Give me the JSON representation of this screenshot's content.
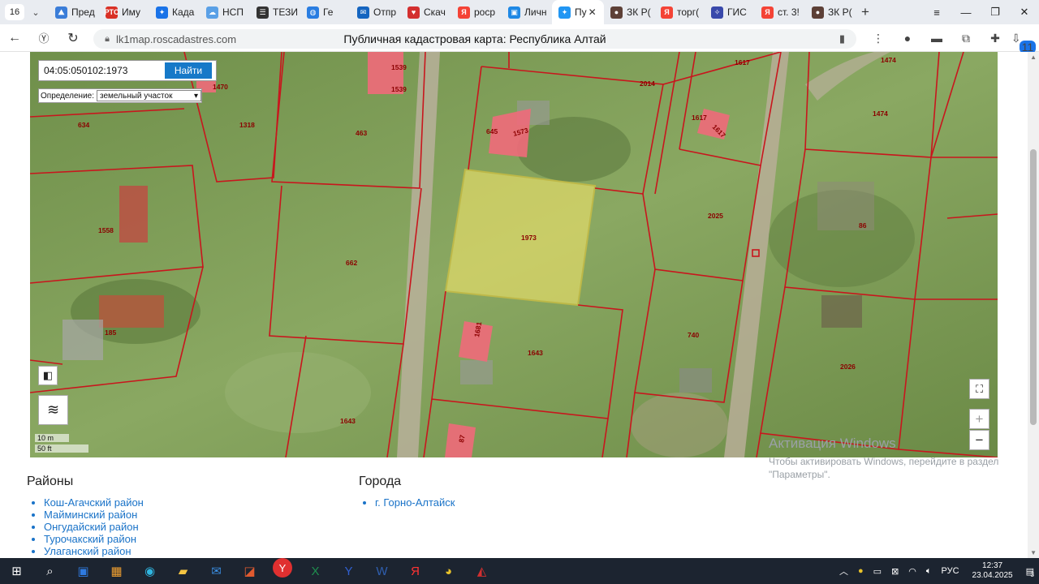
{
  "tabs": {
    "count": "16",
    "items": [
      {
        "label": "Пред",
        "color": "#3b7dd8",
        "glyph": "⛰"
      },
      {
        "label": "Иму",
        "color": "#d93025",
        "glyph": "РТС"
      },
      {
        "label": "Када",
        "color": "#1a73e8",
        "glyph": "✦"
      },
      {
        "label": "НСП",
        "color": "#5aa0e6",
        "glyph": "☁"
      },
      {
        "label": "ТЕЗИ",
        "color": "#333333",
        "glyph": "☰"
      },
      {
        "label": "Ге",
        "color": "#2a7de1",
        "glyph": "◍"
      },
      {
        "label": "Отпр",
        "color": "#1565c0",
        "glyph": "✉"
      },
      {
        "label": "Скач",
        "color": "#d32f2f",
        "glyph": "♥"
      },
      {
        "label": "роср",
        "color": "#f44336",
        "glyph": "Я"
      },
      {
        "label": "Личн",
        "color": "#1e88e5",
        "glyph": "▣"
      },
      {
        "label": "Пу",
        "color": "#2196f3",
        "glyph": "✦",
        "active": true
      },
      {
        "label": "ЗК Р(",
        "color": "#5d4037",
        "glyph": "●"
      },
      {
        "label": "торг(",
        "color": "#f44336",
        "glyph": "Я"
      },
      {
        "label": "ГИС",
        "color": "#3949ab",
        "glyph": "✧"
      },
      {
        "label": "ст. 3!",
        "color": "#f44336",
        "glyph": "Я"
      },
      {
        "label": "ЗК Р(",
        "color": "#5d4037",
        "glyph": "●"
      }
    ]
  },
  "address": {
    "url": "lk1map.roscadastres.com",
    "page_title": "Публичная кадастровая карта: Республика Алтай",
    "extensions_badge": "11"
  },
  "map": {
    "search_value": "04:05:050102:1973",
    "search_button": "Найти",
    "definition_label": "Определение:",
    "definition_value": "земельный участок",
    "scale_metric": "10 m",
    "scale_imperial": "50 ft",
    "plot_labels": [
      "1539",
      "1539",
      "463",
      "1318",
      "1470",
      "1318",
      "634",
      "645",
      "1573",
      "2014",
      "1617",
      "1617",
      "1474",
      "1474",
      "1558",
      "1973",
      "2025",
      "86",
      "662",
      "185",
      "1643",
      "1643",
      "740",
      "2026",
      "87",
      "1681",
      "1617"
    ]
  },
  "districts": {
    "title": "Районы",
    "items": [
      "Кош-Агачский район",
      "Майминский район",
      "Онгудайский район",
      "Турочакский район",
      "Улаганский район"
    ]
  },
  "cities": {
    "title": "Города",
    "items": [
      "г. Горно-Алтайск"
    ]
  },
  "activation": {
    "title": "Активация Windows",
    "subtitle": "Чтобы активировать Windows, перейдите в раздел \"Параметры\"."
  },
  "taskbar": {
    "icons": [
      "start-icon",
      "search-icon",
      "store-bag-icon",
      "microsoft-store-icon",
      "edge-icon",
      "file-explorer-icon",
      "mail-icon",
      "office-icon",
      "yandex-browser-icon",
      "excel-icon",
      "yandex-icon",
      "word-icon",
      "yandex-search-icon",
      "chrome-icon",
      "pdf-icon"
    ],
    "lang": "РУС",
    "time": "12:37",
    "date": "23.04.2025",
    "notifications": "3"
  }
}
